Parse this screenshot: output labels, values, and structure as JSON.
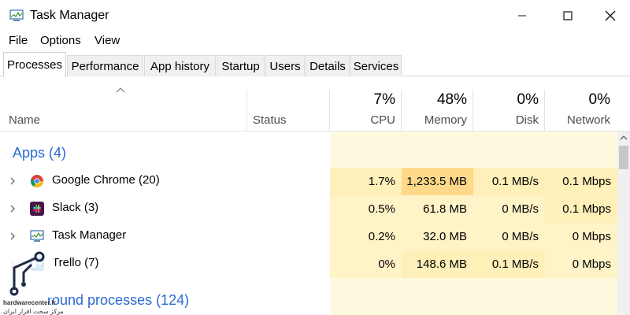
{
  "window": {
    "title": "Task Manager",
    "controls": {
      "minimize": "minimize",
      "maximize": "maximize",
      "close": "close"
    }
  },
  "menu": [
    "File",
    "Options",
    "View"
  ],
  "tabs": [
    "Processes",
    "Performance",
    "App history",
    "Startup",
    "Users",
    "Details",
    "Services"
  ],
  "active_tab": "Processes",
  "header": {
    "name": "Name",
    "status": "Status",
    "cpu": {
      "percent": "7%",
      "label": "CPU"
    },
    "memory": {
      "percent": "48%",
      "label": "Memory"
    },
    "disk": {
      "percent": "0%",
      "label": "Disk"
    },
    "network": {
      "percent": "0%",
      "label": "Network"
    }
  },
  "groups": {
    "apps": "Apps (4)",
    "background": "round processes (124)"
  },
  "processes": [
    {
      "name": "Google Chrome (20)",
      "icon": "chrome-icon",
      "cpu": "1.7%",
      "memory": "1,233.5 MB",
      "disk": "0.1 MB/s",
      "network": "0.1 Mbps"
    },
    {
      "name": "Slack (3)",
      "icon": "slack-icon",
      "cpu": "0.5%",
      "memory": "61.8 MB",
      "disk": "0 MB/s",
      "network": "0.1 Mbps"
    },
    {
      "name": "Task Manager",
      "icon": "task-manager-icon",
      "cpu": "0.2%",
      "memory": "32.0 MB",
      "disk": "0 MB/s",
      "network": "0 Mbps"
    },
    {
      "name": "Trello (7)",
      "icon": "trello-icon",
      "cpu": "0%",
      "memory": "148.6 MB",
      "disk": "0.1 MB/s",
      "network": "0 Mbps"
    }
  ],
  "watermark": {
    "site": "hardwarecenter.ir",
    "tagline": "مرکز سخت افزار ایران"
  },
  "colors": {
    "accent": "#2a6ad3",
    "heat_light": "#fff9e0",
    "heat_mid": "#fff0c0",
    "heat_strong": "#ffd98a"
  }
}
